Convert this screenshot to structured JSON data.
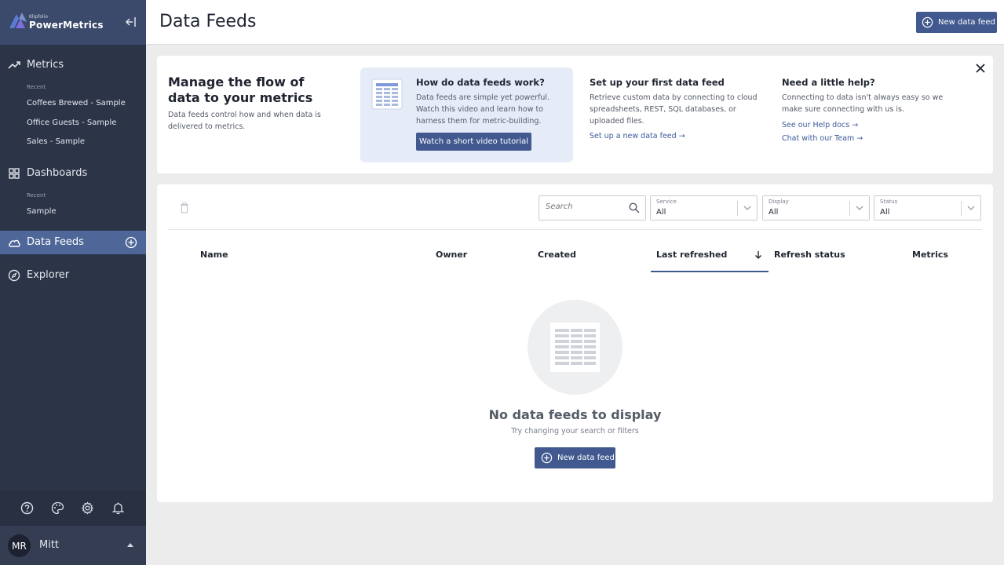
{
  "brand": {
    "small": "Klipfolio",
    "name": "PowerMetrics"
  },
  "nav": {
    "metrics": {
      "label": "Metrics",
      "recent_label": "Recent",
      "recent": [
        "Coffees Brewed - Sample",
        "Office Guests - Sample",
        "Sales - Sample"
      ]
    },
    "dashboards": {
      "label": "Dashboards",
      "recent_label": "Recent",
      "recent": [
        "Sample"
      ]
    },
    "data_feeds": {
      "label": "Data Feeds"
    },
    "explorer": {
      "label": "Explorer"
    }
  },
  "user": {
    "initials": "MR",
    "name": "Mitt"
  },
  "header": {
    "title": "Data Feeds",
    "new_button": "New data feed"
  },
  "info": {
    "heading": "Manage the flow of data to your metrics",
    "description": "Data feeds control how and when data is delivered to metrics.",
    "howto": {
      "title": "How do data feeds work?",
      "desc": "Data feeds are simple yet powerful. Watch this video and learn how to harness them for metric-building.",
      "button": "Watch a short video tutorial"
    },
    "setup": {
      "title": "Set up your first data feed",
      "desc": "Retrieve custom data by connecting to cloud spreadsheets, REST, SQL databases, or uploaded files.",
      "link": "Set up a new data feed →"
    },
    "help": {
      "title": "Need a little help?",
      "desc": "Connecting to data isn't always easy so we make sure connecting with us is.",
      "link_docs": "See our Help docs →",
      "link_team": "Chat with our Team →"
    }
  },
  "filters": {
    "search_placeholder": "Search",
    "service": {
      "label": "Service",
      "value": "All"
    },
    "display": {
      "label": "Display",
      "value": "All"
    },
    "status": {
      "label": "Status",
      "value": "All"
    }
  },
  "table": {
    "columns": [
      "Name",
      "Owner",
      "Created",
      "Last refreshed",
      "Refresh status",
      "Metrics"
    ],
    "sorted_column": "Last refreshed"
  },
  "empty": {
    "title": "No data feeds to display",
    "subtitle": "Try changing your search or filters",
    "button": "New data feed"
  },
  "colors": {
    "sidebar": "#2c3447",
    "brand_bar": "#3b4a6b",
    "active_nav": "#4e6798",
    "primary": "#41598f",
    "link": "#3a5a9a"
  }
}
